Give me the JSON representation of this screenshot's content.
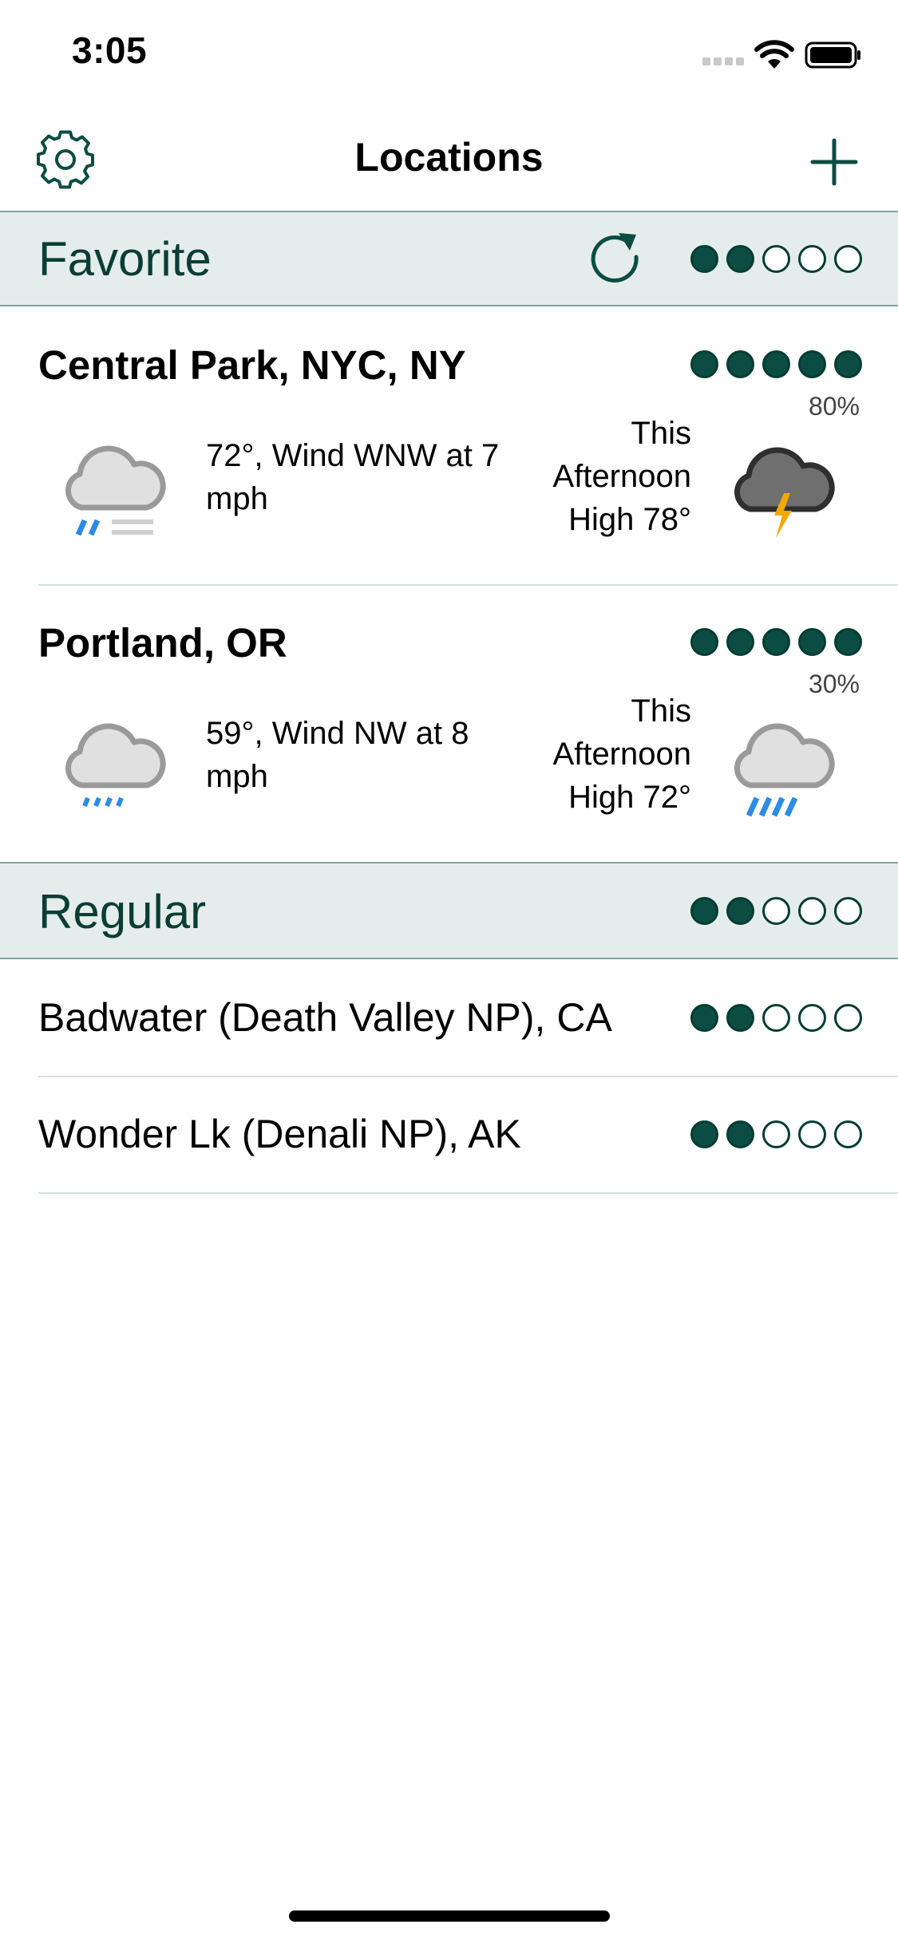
{
  "status_bar": {
    "time": "3:05"
  },
  "nav": {
    "title": "Locations",
    "settings_icon": "gear-icon",
    "add_icon": "plus-icon"
  },
  "colors": {
    "accent": "#0b4d42",
    "section_bg": "#e5edec",
    "rain": "#2b8be6",
    "lightning": "#f2a900"
  },
  "favorite_section": {
    "title": "Favorite",
    "refresh_icon": "refresh-icon",
    "rating": 2,
    "rating_max": 5
  },
  "favorites": [
    {
      "name": "Central Park, NYC, NY",
      "rating": 5,
      "current": "72°, Wind WNW at 7 mph",
      "current_icon": "cloud-fog-rain-icon",
      "forecast_line1": "This",
      "forecast_line2": "Afternoon",
      "forecast_line3": "High 78°",
      "precip": "80%",
      "forecast_icon": "thunderstorm-icon"
    },
    {
      "name": "Portland, OR",
      "rating": 5,
      "current": "59°, Wind NW at 8 mph",
      "current_icon": "cloud-light-rain-icon",
      "forecast_line1": "This",
      "forecast_line2": "Afternoon",
      "forecast_line3": "High 72°",
      "precip": "30%",
      "forecast_icon": "cloud-rain-icon"
    }
  ],
  "regular_section": {
    "title": "Regular",
    "rating": 2,
    "rating_max": 5
  },
  "regulars": [
    {
      "name": "Badwater (Death Valley NP), CA",
      "rating": 2
    },
    {
      "name": "Wonder Lk (Denali NP), AK",
      "rating": 2
    }
  ]
}
